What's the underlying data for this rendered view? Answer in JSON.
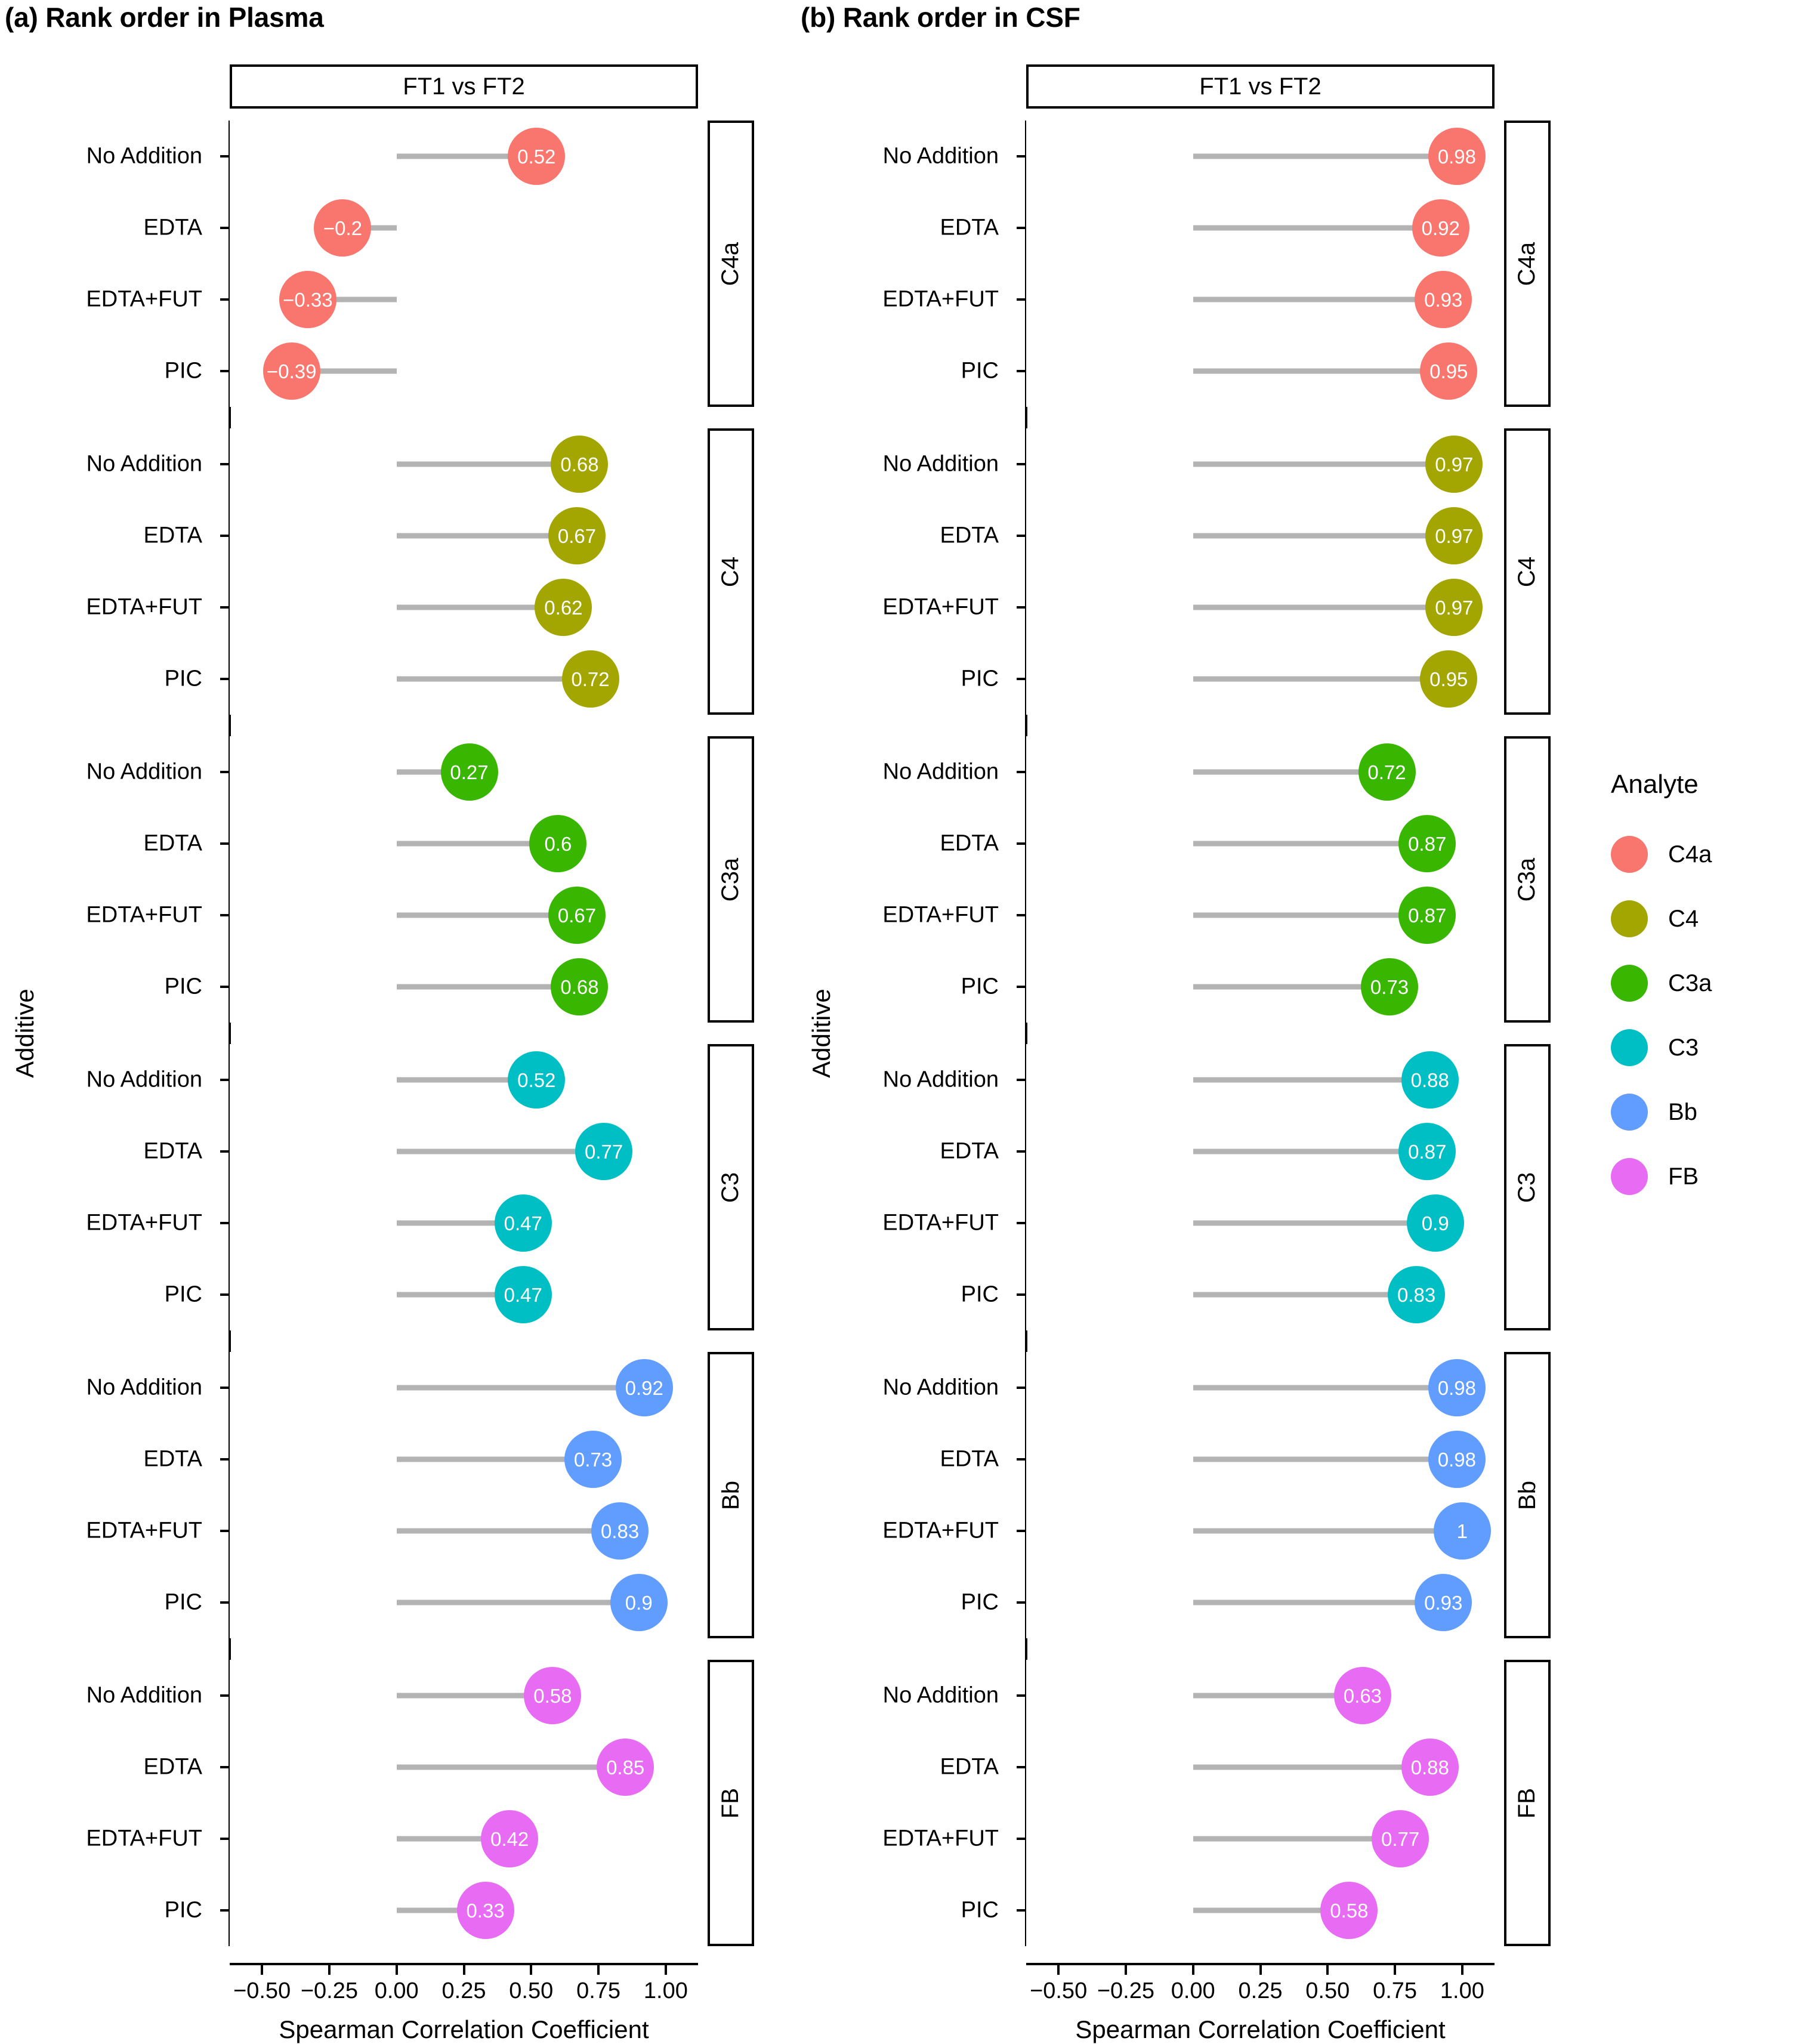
{
  "panels": [
    {
      "id": "a",
      "title": "(a) Rank order in Plasma",
      "strip": "FT1 vs FT2"
    },
    {
      "id": "b",
      "title": "(b) Rank order in CSF",
      "strip": "FT1 vs FT2"
    }
  ],
  "axis": {
    "xlabel": "Spearman Correlation Coefficient",
    "ylabel": "Additive",
    "xticks": [
      "-0.50",
      "-0.25",
      "0.00",
      "0.25",
      "0.50",
      "0.75",
      "1.00"
    ],
    "xtickvalues": [
      -0.5,
      -0.25,
      0,
      0.25,
      0.5,
      0.75,
      1.0
    ],
    "xlim": [
      -0.62,
      1.12
    ]
  },
  "additives": [
    "No Addition",
    "EDTA",
    "EDTA+FUT",
    "PIC"
  ],
  "legend": {
    "title": "Analyte",
    "items": [
      {
        "label": "C4a",
        "color": "#F8766D"
      },
      {
        "label": "C4",
        "color": "#A3A500"
      },
      {
        "label": "C3a",
        "color": "#39B600"
      },
      {
        "label": "C3",
        "color": "#00BFC4"
      },
      {
        "label": "Bb",
        "color": "#619CFF"
      },
      {
        "label": "FB",
        "color": "#E76BF3"
      }
    ]
  },
  "chart_data": {
    "type": "scatter",
    "title": "Rank order correlation (FT1 vs FT2) by analyte and additive",
    "xlabel": "Spearman Correlation Coefficient",
    "ylabel": "Additive",
    "xlim": [
      -0.62,
      1.12
    ],
    "grid": false,
    "legend_position": "right",
    "categories": [
      "No Addition",
      "EDTA",
      "EDTA+FUT",
      "PIC"
    ],
    "panels": [
      {
        "panel": "a",
        "panel_title": "(a) Rank order in Plasma",
        "strip": "FT1 vs FT2",
        "facets": [
          {
            "analyte": "C4a",
            "color": "#F8766D",
            "values": [
              0.52,
              -0.2,
              -0.33,
              -0.39
            ],
            "labels": [
              "0.52",
              "−0.2",
              "−0.33",
              "−0.39"
            ]
          },
          {
            "analyte": "C4",
            "color": "#A3A500",
            "values": [
              0.68,
              0.67,
              0.62,
              0.72
            ],
            "labels": [
              "0.68",
              "0.67",
              "0.62",
              "0.72"
            ]
          },
          {
            "analyte": "C3a",
            "color": "#39B600",
            "values": [
              0.27,
              0.6,
              0.67,
              0.68
            ],
            "labels": [
              "0.27",
              "0.6",
              "0.67",
              "0.68"
            ]
          },
          {
            "analyte": "C3",
            "color": "#00BFC4",
            "values": [
              0.52,
              0.77,
              0.47,
              0.47
            ],
            "labels": [
              "0.52",
              "0.77",
              "0.47",
              "0.47"
            ]
          },
          {
            "analyte": "Bb",
            "color": "#619CFF",
            "values": [
              0.92,
              0.73,
              0.83,
              0.9
            ],
            "labels": [
              "0.92",
              "0.73",
              "0.83",
              "0.9"
            ]
          },
          {
            "analyte": "FB",
            "color": "#E76BF3",
            "values": [
              0.58,
              0.85,
              0.42,
              0.33
            ],
            "labels": [
              "0.58",
              "0.85",
              "0.42",
              "0.33"
            ]
          }
        ]
      },
      {
        "panel": "b",
        "panel_title": "(b) Rank order in CSF",
        "strip": "FT1 vs FT2",
        "facets": [
          {
            "analyte": "C4a",
            "color": "#F8766D",
            "values": [
              0.98,
              0.92,
              0.93,
              0.95
            ],
            "labels": [
              "0.98",
              "0.92",
              "0.93",
              "0.95"
            ]
          },
          {
            "analyte": "C4",
            "color": "#A3A500",
            "values": [
              0.97,
              0.97,
              0.97,
              0.95
            ],
            "labels": [
              "0.97",
              "0.97",
              "0.97",
              "0.95"
            ]
          },
          {
            "analyte": "C3a",
            "color": "#39B600",
            "values": [
              0.72,
              0.87,
              0.87,
              0.73
            ],
            "labels": [
              "0.72",
              "0.87",
              "0.87",
              "0.73"
            ]
          },
          {
            "analyte": "C3",
            "color": "#00BFC4",
            "values": [
              0.88,
              0.87,
              0.9,
              0.83
            ],
            "labels": [
              "0.88",
              "0.87",
              "0.9",
              "0.83"
            ]
          },
          {
            "analyte": "Bb",
            "color": "#619CFF",
            "values": [
              0.98,
              0.98,
              1.0,
              0.93
            ],
            "labels": [
              "0.98",
              "0.98",
              "1",
              "0.93"
            ]
          },
          {
            "analyte": "FB",
            "color": "#E76BF3",
            "values": [
              0.63,
              0.88,
              0.77,
              0.58
            ],
            "labels": [
              "0.63",
              "0.88",
              "0.77",
              "0.58"
            ]
          }
        ]
      }
    ]
  }
}
